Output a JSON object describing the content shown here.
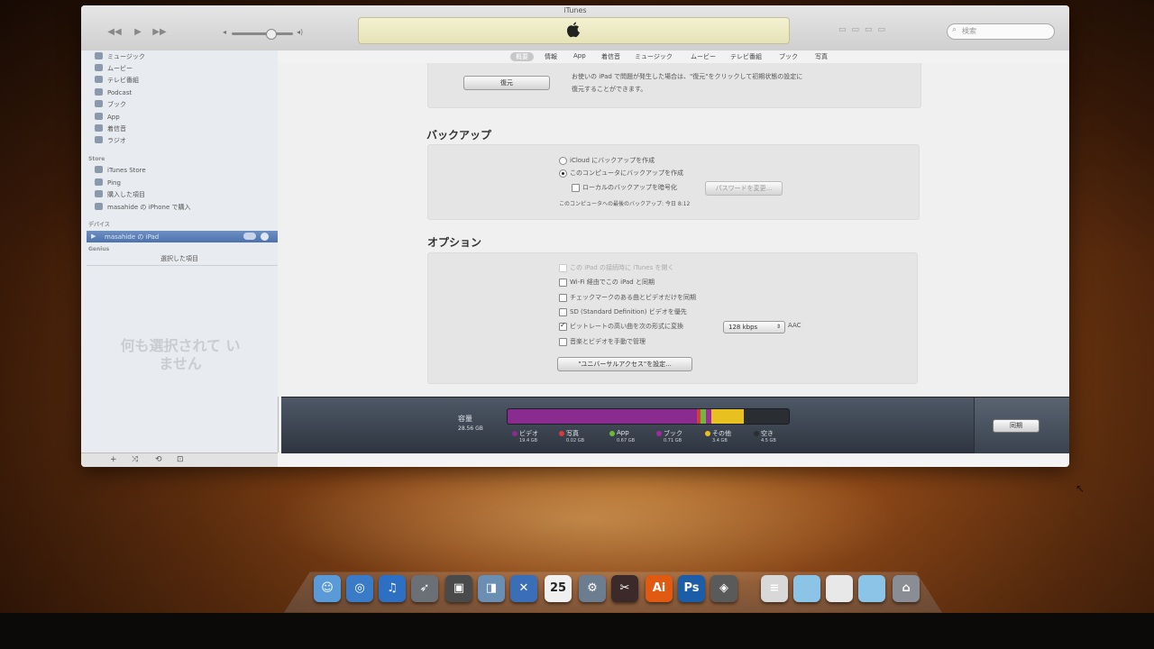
{
  "window": {
    "title": "iTunes",
    "search_placeholder": "検索"
  },
  "sidebar": {
    "library": [
      "ミュージック",
      "ムービー",
      "テレビ番組",
      "Podcast",
      "ブック",
      "App",
      "着信音",
      "ラジオ"
    ],
    "store_header": "Store",
    "store": [
      "iTunes Store",
      "Ping",
      "購入した項目",
      "masahide の iPhone で購入"
    ],
    "devices_header": "デバイス",
    "device_name": "masahide の iPad",
    "genius_header": "Genius",
    "selected_label": "選択した項目",
    "nothing_selected": "何も選択されて いません"
  },
  "tabs": [
    "概要",
    "情報",
    "App",
    "着信音",
    "ミュージック",
    "ムービー",
    "テレビ番組",
    "ブック",
    "写真"
  ],
  "restore": {
    "button": "復元",
    "text1": "お使いの iPad で問題が発生した場合は、\"復元\"をクリックして初期状態の設定に",
    "text2": "復元することができます。"
  },
  "backup": {
    "title": "バックアップ",
    "icloud": "iCloud にバックアップを作成",
    "computer": "このコンピュータにバックアップを作成",
    "encrypt": "ローカルのバックアップを暗号化",
    "password_button": "パスワードを変更...",
    "last_backup": "このコンピュータへの最後のバックアップ:  今日 8:12"
  },
  "options": {
    "title": "オプション",
    "open_itunes": "この iPad の接続時に iTunes を開く",
    "wifi_sync": "Wi-Fi 経由でこの iPad と同期",
    "checked_only": "チェックマークのある曲とビデオだけを同期",
    "prefer_sd": "SD (Standard Definition) ビデオを優先",
    "convert_bitrate": "ビットレートの高い曲を次の形式に変換",
    "bitrate": "128 kbps",
    "format": "AAC",
    "manual": "音楽とビデオを手動で管理",
    "accessibility_button": "\"ユニバーサルアクセス\"を設定..."
  },
  "capacity": {
    "label": "容量",
    "total": "28.56 GB",
    "sync_button": "同期",
    "colors": {
      "video": "#8a2b8f",
      "photo": "#d63a3a",
      "app": "#6fb83a",
      "book": "#a02aa0",
      "other": "#e8c020",
      "free": "#2a2e33"
    },
    "segments": [
      {
        "key": "video",
        "name": "ビデオ",
        "size": "19.4 GB"
      },
      {
        "key": "photo",
        "name": "写真",
        "size": "0.02 GB"
      },
      {
        "key": "app",
        "name": "App",
        "size": "0.67 GB"
      },
      {
        "key": "book",
        "name": "ブック",
        "size": "0.71 GB"
      },
      {
        "key": "other",
        "name": "その他",
        "size": "3.4 GB"
      },
      {
        "key": "free",
        "name": "空き",
        "size": "4.5 GB"
      }
    ]
  },
  "dock": {
    "items": [
      {
        "name": "finder-icon",
        "color": "#5a9ad8",
        "glyph": "☺"
      },
      {
        "name": "safari-icon",
        "color": "#3a7bc8",
        "glyph": "◎"
      },
      {
        "name": "itunes-icon",
        "color": "#2d6fc2",
        "glyph": "♫"
      },
      {
        "name": "launchpad-icon",
        "color": "#6b6f76",
        "glyph": "➶"
      },
      {
        "name": "photo-booth-icon",
        "color": "#4a4a4a",
        "glyph": "▣"
      },
      {
        "name": "preview-icon",
        "color": "#6a8fb3",
        "glyph": "◨"
      },
      {
        "name": "xcode-icon",
        "color": "#3a6fb8",
        "glyph": "✕"
      },
      {
        "name": "calendar-icon",
        "color": "#f0f0f0",
        "glyph": "25"
      },
      {
        "name": "system-prefs-icon",
        "color": "#6d7d90",
        "glyph": "⚙"
      },
      {
        "name": "photoshop-tools-icon",
        "color": "#3c2a2a",
        "glyph": "✂"
      },
      {
        "name": "illustrator-icon",
        "color": "#e05a12",
        "glyph": "Ai"
      },
      {
        "name": "photoshop-icon",
        "color": "#1c5da8",
        "glyph": "Ps"
      },
      {
        "name": "utility-icon",
        "color": "#5a5a5a",
        "glyph": "◈"
      },
      {
        "name": "documents-icon",
        "color": "#d8d8d8",
        "glyph": "≡"
      },
      {
        "name": "folder-icon",
        "color": "#8cc4e8",
        "glyph": ""
      },
      {
        "name": "file-icon",
        "color": "#e8e8e8",
        "glyph": ""
      },
      {
        "name": "downloads-folder-icon",
        "color": "#8cc4e8",
        "glyph": ""
      },
      {
        "name": "trash-icon",
        "color": "#8a8e94",
        "glyph": "⌂"
      }
    ]
  }
}
